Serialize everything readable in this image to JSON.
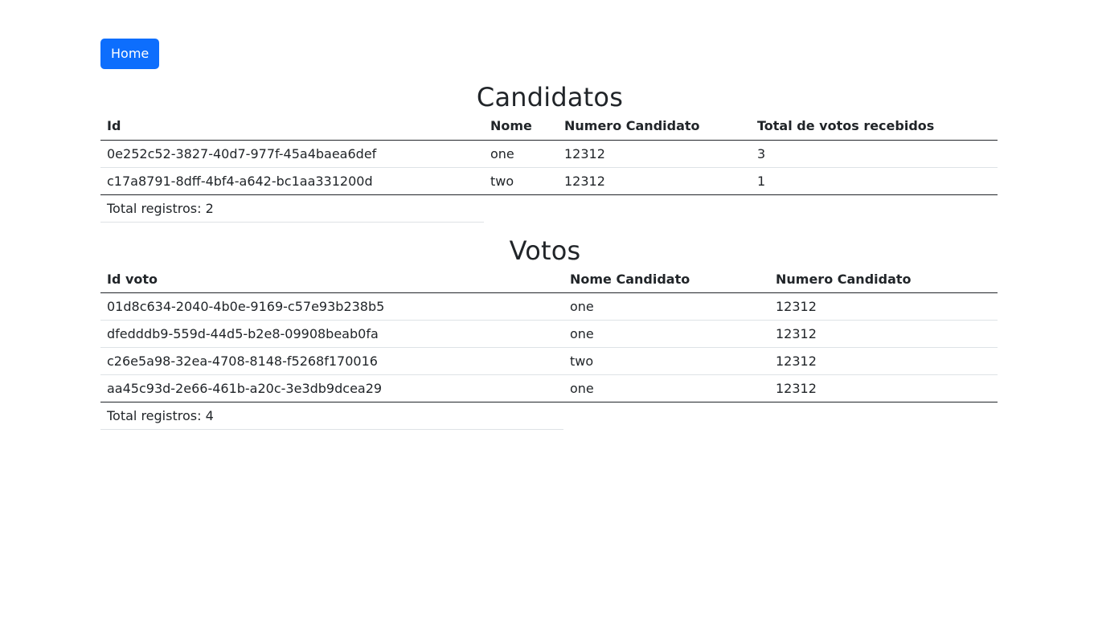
{
  "nav": {
    "home_label": "Home"
  },
  "candidatos": {
    "title": "Candidatos",
    "columns": [
      "Id",
      "Nome",
      "Numero Candidato",
      "Total de votos recebidos"
    ],
    "rows": [
      [
        "0e252c52-3827-40d7-977f-45a4baea6def",
        "one",
        "12312",
        "3"
      ],
      [
        "c17a8791-8dff-4bf4-a642-bc1aa331200d",
        "two",
        "12312",
        "1"
      ]
    ],
    "total_label": "Total registros: 2"
  },
  "votos": {
    "title": "Votos",
    "columns": [
      "Id voto",
      "Nome Candidato",
      "Numero Candidato"
    ],
    "rows": [
      [
        "01d8c634-2040-4b0e-9169-c57e93b238b5",
        "one",
        "12312"
      ],
      [
        "dfedddb9-559d-44d5-b2e8-09908beab0fa",
        "one",
        "12312"
      ],
      [
        "c26e5a98-32ea-4708-8148-f5268f170016",
        "two",
        "12312"
      ],
      [
        "aa45c93d-2e66-461b-a20c-3e3db9dcea29",
        "one",
        "12312"
      ]
    ],
    "total_label": "Total registros: 4"
  },
  "colors": {
    "primary": "#0d6efd",
    "text": "#212529",
    "border_light": "#dee2e6"
  }
}
